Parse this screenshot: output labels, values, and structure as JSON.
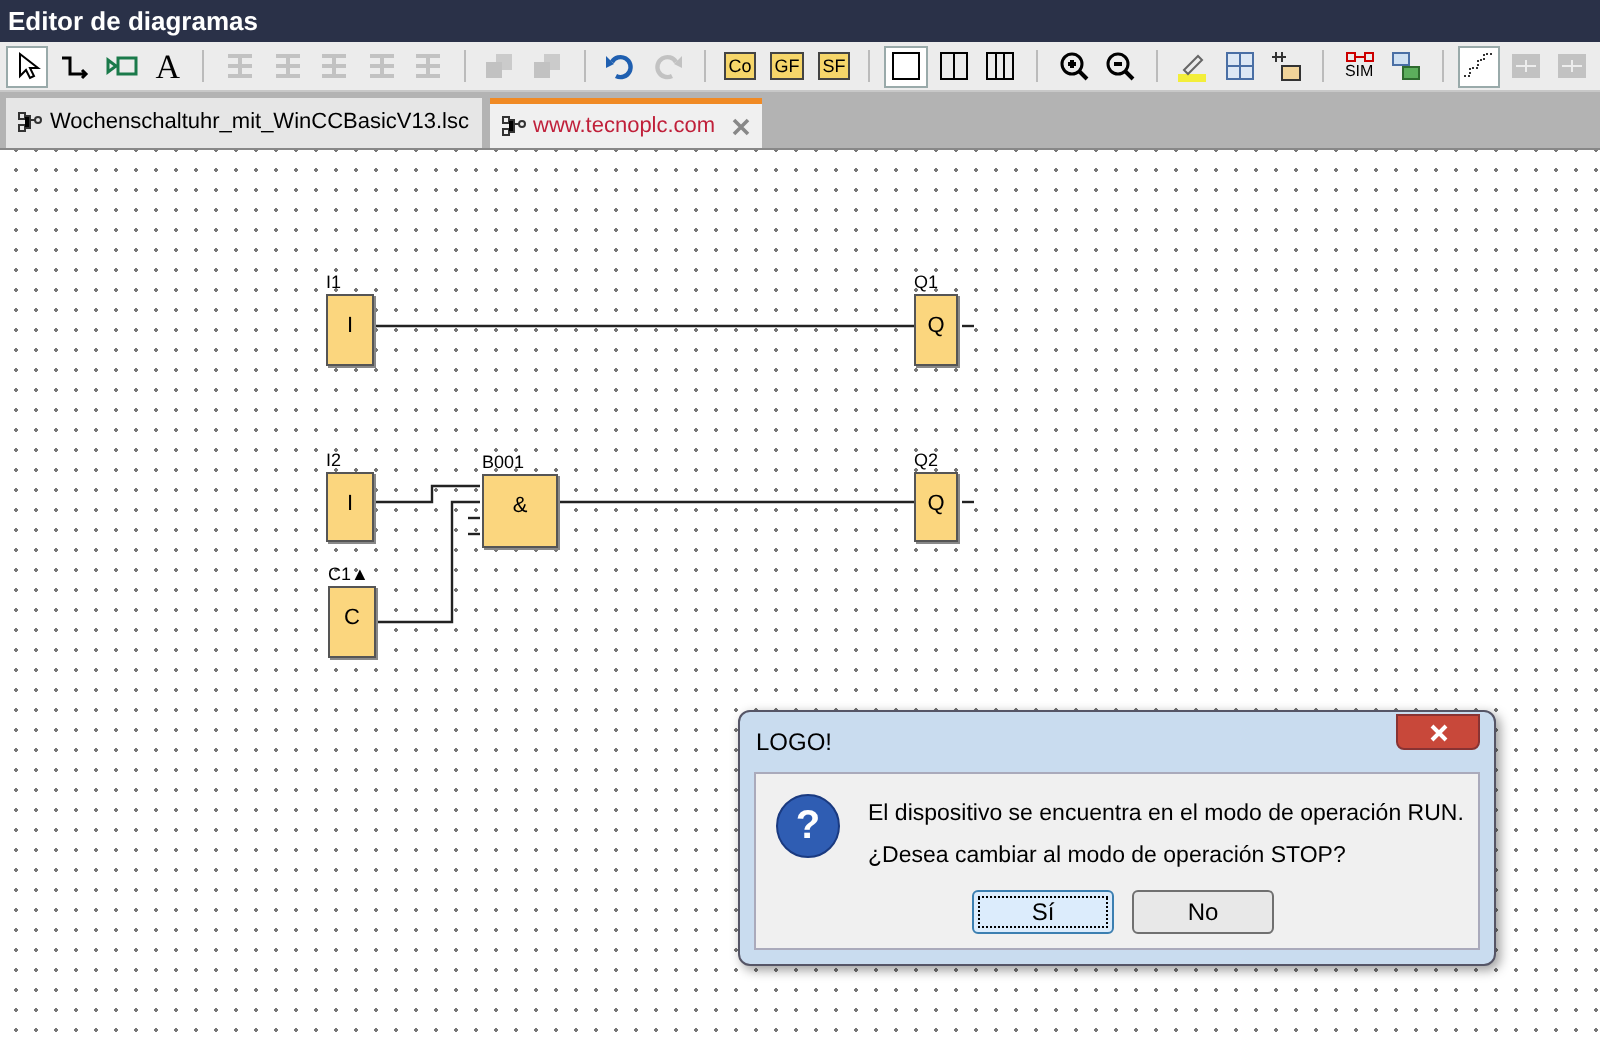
{
  "window": {
    "title": "Editor de diagramas"
  },
  "toolbar": {
    "groups": [
      [
        {
          "selected": true,
          "disabled": false
        },
        {
          "selected": false,
          "disabled": false
        },
        {
          "selected": false,
          "disabled": false
        },
        {
          "label": "A",
          "selected": false,
          "disabled": false
        }
      ],
      [
        {
          "selected": false,
          "disabled": true
        },
        {
          "selected": false,
          "disabled": true
        },
        {
          "selected": false,
          "disabled": true
        },
        {
          "selected": false,
          "disabled": true
        },
        {
          "selected": false,
          "disabled": true
        }
      ],
      [
        {
          "selected": false,
          "disabled": true
        },
        {
          "selected": false,
          "disabled": true
        }
      ],
      [
        {
          "selected": false,
          "disabled": false
        },
        {
          "selected": false,
          "disabled": true
        }
      ],
      [
        {
          "label": "Co",
          "selected": false,
          "disabled": false
        },
        {
          "label": "GF",
          "selected": false,
          "disabled": false
        },
        {
          "label": "SF",
          "selected": false,
          "disabled": false
        }
      ],
      [
        {
          "selected": true,
          "disabled": false
        },
        {
          "selected": false,
          "disabled": false
        },
        {
          "selected": false,
          "disabled": false
        }
      ],
      [
        {
          "selected": false,
          "disabled": false
        },
        {
          "selected": false,
          "disabled": false
        }
      ],
      [
        {
          "selected": false,
          "disabled": false
        },
        {
          "selected": false,
          "disabled": false
        },
        {
          "selected": false,
          "disabled": false
        }
      ],
      [
        {
          "label": "SIM",
          "selected": false,
          "disabled": false
        },
        {
          "selected": false,
          "disabled": false
        }
      ],
      [
        {
          "selected": true,
          "disabled": false
        },
        {
          "selected": false,
          "disabled": true
        },
        {
          "selected": false,
          "disabled": true
        }
      ]
    ]
  },
  "tabs": [
    {
      "label": "Wochenschaltuhr_mit_WinCCBasicV13.lsc",
      "selected": false
    },
    {
      "label": "www.tecnoplc.com",
      "selected": true
    }
  ],
  "diagram": {
    "blocks": [
      {
        "label": "I1",
        "symbol": "I"
      },
      {
        "label": "Q1",
        "symbol": "Q"
      },
      {
        "label": "I2",
        "symbol": "I"
      },
      {
        "label": "B001",
        "symbol": "&"
      },
      {
        "label": "Q2",
        "symbol": "Q"
      },
      {
        "label": "C1▲",
        "symbol": "C"
      }
    ]
  },
  "dialog": {
    "title": "LOGO!",
    "icon_glyph": "?",
    "message": [
      "El dispositivo se encuentra en el modo de operación RUN.",
      "¿Desea cambiar al modo de operación STOP?"
    ],
    "buttons": [
      {
        "label": "Sí",
        "selected": true
      },
      {
        "label": "No",
        "selected": false
      }
    ]
  }
}
